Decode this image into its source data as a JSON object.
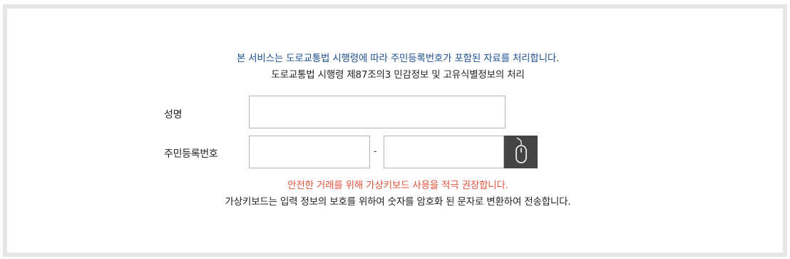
{
  "notice": {
    "line1": "본 서비스는 도로교통법 시행령에 따라 주민등록번호가 포함된 자료를 처리합니다.",
    "line2": "도로교통법 시행령 제87조의3 민감정보 및 고유식별정보의 처리"
  },
  "form": {
    "name_label": "성명",
    "name_value": "",
    "rrn_label": "주민등록번호",
    "rrn_front_value": "",
    "rrn_separator": "-",
    "rrn_back_value": "",
    "virtual_keyboard_icon": "mouse-icon"
  },
  "messages": {
    "warning": "안전한 거래를 위해 가상키보드 사용을 적극 권장합니다.",
    "info": "가상키보드는 입력 정보의 보호를 위하여 숫자를 암호화 된 문자로 변환하여 전송합니다."
  },
  "colors": {
    "notice_blue": "#1d4f91",
    "warning_red": "#e0533c",
    "button_dark": "#444444",
    "frame_border": "#e6e6e6"
  }
}
